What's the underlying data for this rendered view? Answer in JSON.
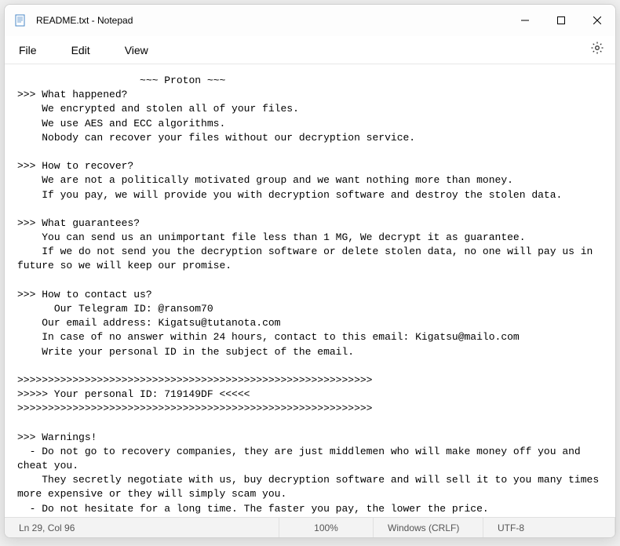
{
  "window": {
    "title": "README.txt - Notepad"
  },
  "menu": {
    "file": "File",
    "edit": "Edit",
    "view": "View"
  },
  "content": {
    "text": "                    ~~~ Proton ~~~\n>>> What happened?\n    We encrypted and stolen all of your files.\n    We use AES and ECC algorithms.\n    Nobody can recover your files without our decryption service.\n\n>>> How to recover?\n    We are not a politically motivated group and we want nothing more than money.\n    If you pay, we will provide you with decryption software and destroy the stolen data.\n\n>>> What guarantees?\n    You can send us an unimportant file less than 1 MG, We decrypt it as guarantee.\n    If we do not send you the decryption software or delete stolen data, no one will pay us in future so we will keep our promise.\n\n>>> How to contact us?\n      Our Telegram ID: @ransom70\n    Our email address: Kigatsu@tutanota.com\n    In case of no answer within 24 hours, contact to this email: Kigatsu@mailo.com\n    Write your personal ID in the subject of the email.\n\n>>>>>>>>>>>>>>>>>>>>>>>>>>>>>>>>>>>>>>>>>>>>>>>>>>>>>>>>>>\n>>>>> Your personal ID: 719149DF <<<<<\n>>>>>>>>>>>>>>>>>>>>>>>>>>>>>>>>>>>>>>>>>>>>>>>>>>>>>>>>>>\n\n>>> Warnings!\n  - Do not go to recovery companies, they are just middlemen who will make money off you and cheat you.\n    They secretly negotiate with us, buy decryption software and will sell it to you many times more expensive or they will simply scam you.\n  - Do not hesitate for a long time. The faster you pay, the lower the price.\n  - Do not delete or modify encrypted files, it will lead to problems with decryption of files."
  },
  "status": {
    "position": "Ln 29, Col 96",
    "zoom": "100%",
    "line_ending": "Windows (CRLF)",
    "encoding": "UTF-8"
  }
}
